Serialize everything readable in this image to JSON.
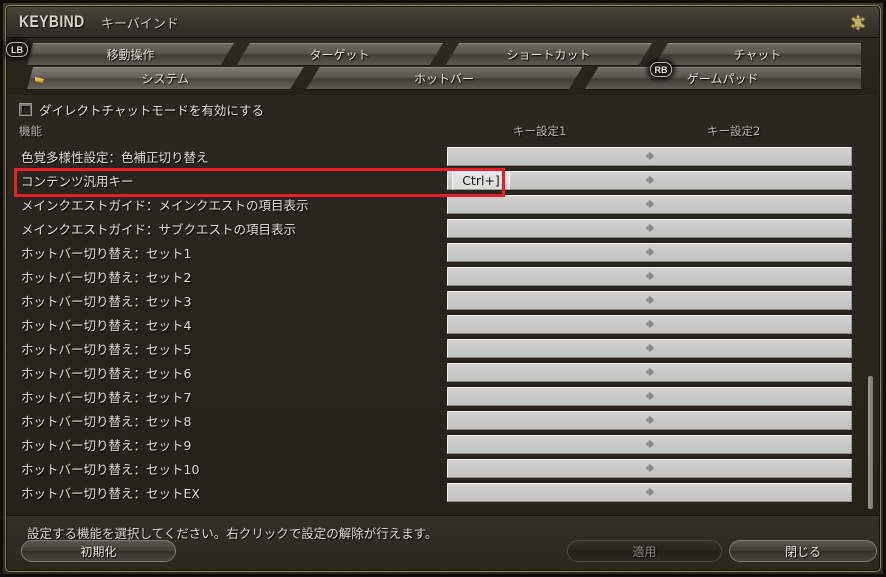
{
  "window": {
    "title_en": "KEYBIND",
    "title_jp": "キーバインド",
    "handle_icon": "resize-handle-icon"
  },
  "tabs": {
    "left_bumper": "LB",
    "right_bumper": "RB",
    "row1": [
      {
        "label": "移動操作",
        "active": false
      },
      {
        "label": "ターゲット",
        "active": false
      },
      {
        "label": "ショートカット",
        "active": false
      },
      {
        "label": "チャット",
        "active": false
      }
    ],
    "row2": [
      {
        "label": "システム",
        "active": true
      },
      {
        "label": "ホットバー",
        "active": false
      },
      {
        "label": "ゲームパッド",
        "active": false
      }
    ]
  },
  "options": {
    "direct_chat": {
      "label": "ダイレクトチャットモードを有効にする",
      "checked": false
    }
  },
  "columns": {
    "function": "機能",
    "key1": "キー設定1",
    "key2": "キー設定2"
  },
  "rows": [
    {
      "label": "色覚多様性設定：色補正切り替え",
      "key1": "",
      "key2": ""
    },
    {
      "label": "コンテンツ汎用キー",
      "key1": "Ctrl+]",
      "key2": "",
      "highlighted": true
    },
    {
      "label": "メインクエストガイド：メインクエストの項目表示",
      "key1": "",
      "key2": ""
    },
    {
      "label": "メインクエストガイド：サブクエストの項目表示",
      "key1": "",
      "key2": ""
    },
    {
      "label": "ホットバー切り替え：セット1",
      "key1": "",
      "key2": ""
    },
    {
      "label": "ホットバー切り替え：セット2",
      "key1": "",
      "key2": ""
    },
    {
      "label": "ホットバー切り替え：セット3",
      "key1": "",
      "key2": ""
    },
    {
      "label": "ホットバー切り替え：セット4",
      "key1": "",
      "key2": ""
    },
    {
      "label": "ホットバー切り替え：セット5",
      "key1": "",
      "key2": ""
    },
    {
      "label": "ホットバー切り替え：セット6",
      "key1": "",
      "key2": ""
    },
    {
      "label": "ホットバー切り替え：セット7",
      "key1": "",
      "key2": ""
    },
    {
      "label": "ホットバー切り替え：セット8",
      "key1": "",
      "key2": ""
    },
    {
      "label": "ホットバー切り替え：セット9",
      "key1": "",
      "key2": ""
    },
    {
      "label": "ホットバー切り替え：セット10",
      "key1": "",
      "key2": ""
    },
    {
      "label": "ホットバー切り替え：セットEX",
      "key1": "",
      "key2": ""
    }
  ],
  "footer": {
    "status": "設定する機能を選択してください。右クリックで設定の解除が行えます。",
    "reset_label": "初期化",
    "apply_label": "適用",
    "close_label": "閉じる"
  },
  "colors": {
    "annotation": "#ee1c24",
    "frame_gold": "#8d8059",
    "keyfield": "#c8c8c8",
    "active_marker": "#ffdf7a"
  }
}
